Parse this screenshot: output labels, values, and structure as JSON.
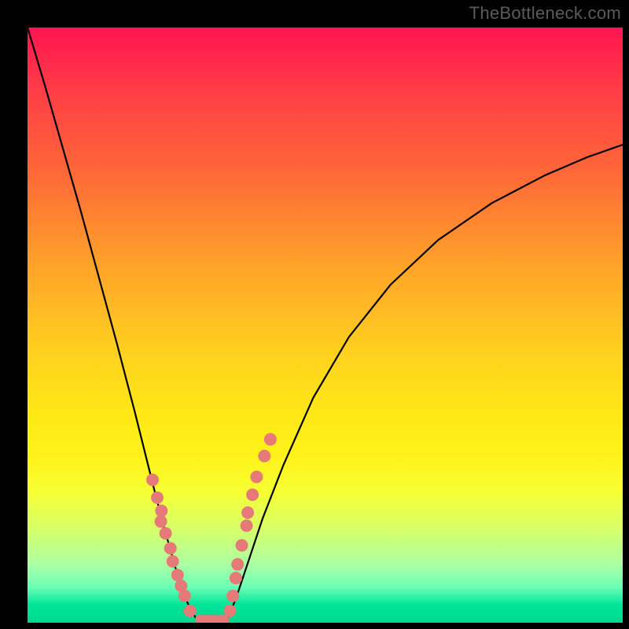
{
  "watermark": "TheBottleneck.com",
  "colors": {
    "dot": "#e67a78",
    "curve": "#000000"
  },
  "chart_data": {
    "type": "line",
    "title": "",
    "xlabel": "",
    "ylabel": "",
    "xlim": [
      0,
      1
    ],
    "ylim": [
      0,
      1
    ],
    "grid": false,
    "note": "Axes are unlabeled in the source image; x and y are normalized 0–1 over the plot area. y = curve height from bottom (0) to top (1).",
    "series": [
      {
        "name": "left-branch",
        "x": [
          0.0,
          0.03,
          0.06,
          0.09,
          0.12,
          0.15,
          0.18,
          0.2,
          0.215,
          0.23,
          0.245,
          0.255,
          0.265,
          0.275,
          0.285
        ],
        "y": [
          1.0,
          0.9,
          0.795,
          0.69,
          0.58,
          0.47,
          0.355,
          0.275,
          0.215,
          0.158,
          0.105,
          0.07,
          0.042,
          0.02,
          0.005
        ]
      },
      {
        "name": "trough",
        "x": [
          0.285,
          0.295,
          0.305,
          0.315,
          0.325,
          0.335
        ],
        "y": [
          0.005,
          0.0,
          0.0,
          0.0,
          0.0,
          0.005
        ]
      },
      {
        "name": "right-branch",
        "x": [
          0.335,
          0.35,
          0.37,
          0.395,
          0.43,
          0.48,
          0.54,
          0.61,
          0.69,
          0.78,
          0.87,
          0.94,
          1.0
        ],
        "y": [
          0.005,
          0.04,
          0.1,
          0.175,
          0.265,
          0.378,
          0.48,
          0.568,
          0.643,
          0.705,
          0.752,
          0.782,
          0.803
        ]
      }
    ],
    "highlight_dots_left": {
      "x": [
        0.21,
        0.218,
        0.225,
        0.224,
        0.232,
        0.24,
        0.244,
        0.252,
        0.258,
        0.264,
        0.273
      ],
      "y": [
        0.24,
        0.21,
        0.188,
        0.17,
        0.15,
        0.125,
        0.103,
        0.08,
        0.062,
        0.045,
        0.02
      ]
    },
    "highlight_dots_right": {
      "x": [
        0.34,
        0.345,
        0.35,
        0.353,
        0.36,
        0.368,
        0.37,
        0.378,
        0.385,
        0.398,
        0.408
      ],
      "y": [
        0.02,
        0.045,
        0.075,
        0.098,
        0.13,
        0.163,
        0.185,
        0.215,
        0.245,
        0.28,
        0.308
      ]
    },
    "trough_bar": {
      "x0": 0.282,
      "x1": 0.338,
      "y": 0.005
    }
  }
}
